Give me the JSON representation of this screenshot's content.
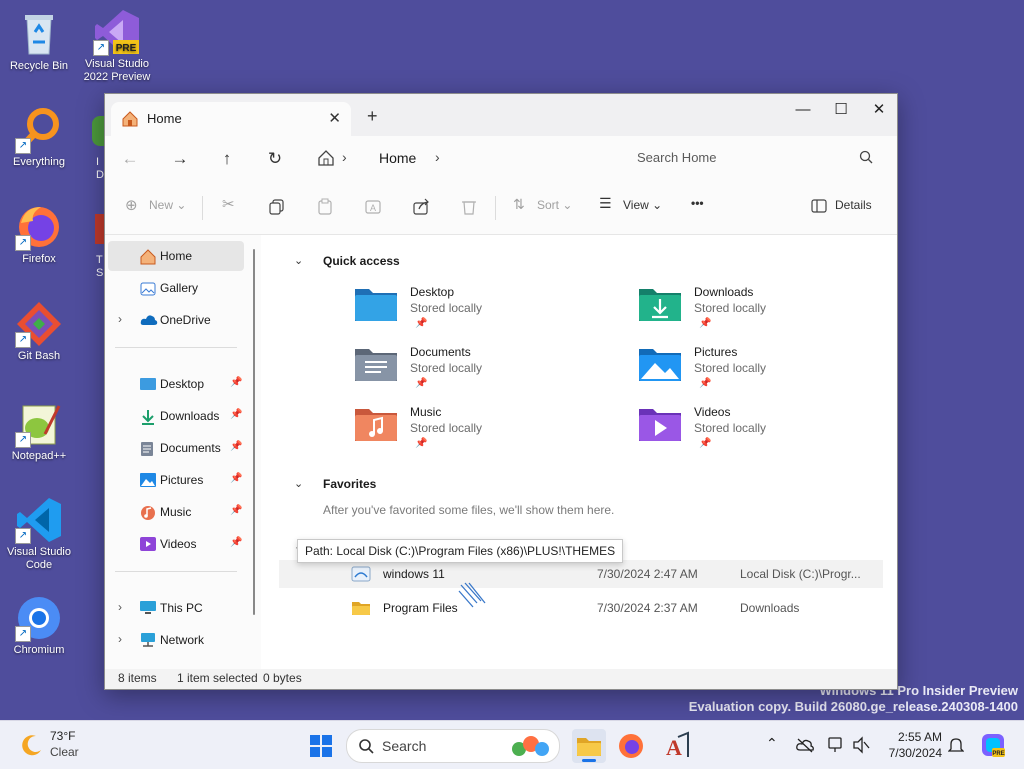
{
  "desktop": {
    "icons": [
      {
        "label": "Recycle Bin",
        "icon": "recycle-bin-icon"
      },
      {
        "label": "Visual Studio 2022 Preview",
        "icon": "visual-studio-preview-icon"
      },
      {
        "label": "Everything",
        "icon": "everything-search-icon"
      },
      {
        "label": "Firefox",
        "icon": "firefox-icon"
      },
      {
        "label": "Git Bash",
        "icon": "git-bash-icon"
      },
      {
        "label": "Notepad++",
        "icon": "notepad-plus-plus-icon"
      },
      {
        "label": "Visual Studio Code",
        "icon": "vscode-icon"
      },
      {
        "label": "Chromium",
        "icon": "chromium-icon"
      }
    ],
    "partial_labels": [
      "I",
      "D",
      "T",
      "S"
    ],
    "watermark_line1": "Windows 11 Pro Insider Preview",
    "watermark_line2": "Evaluation copy. Build 26080.ge_release.240308-1400"
  },
  "explorer": {
    "tab_title": "Home",
    "new_tab": "+",
    "window_controls": {
      "minimize": "—",
      "maximize": "☐",
      "close": "✕"
    },
    "nav": {
      "back": "←",
      "forward": "→",
      "up": "↑",
      "refresh": "↻"
    },
    "address": {
      "crumb": "Home"
    },
    "search_placeholder": "Search Home",
    "toolbar": {
      "new": "New",
      "sort": "Sort",
      "view": "View",
      "more": "•••",
      "details": "Details"
    },
    "sidebar": {
      "top": [
        {
          "label": "Home",
          "selected": true
        },
        {
          "label": "Gallery"
        },
        {
          "label": "OneDrive"
        }
      ],
      "pinned": [
        {
          "label": "Desktop"
        },
        {
          "label": "Downloads"
        },
        {
          "label": "Documents"
        },
        {
          "label": "Pictures"
        },
        {
          "label": "Music"
        },
        {
          "label": "Videos"
        }
      ],
      "bottom": [
        {
          "label": "This PC"
        },
        {
          "label": "Network"
        }
      ]
    },
    "quick_access": {
      "title": "Quick access",
      "items": [
        {
          "name": "Desktop",
          "sub": "Stored locally"
        },
        {
          "name": "Downloads",
          "sub": "Stored locally"
        },
        {
          "name": "Documents",
          "sub": "Stored locally"
        },
        {
          "name": "Pictures",
          "sub": "Stored locally"
        },
        {
          "name": "Music",
          "sub": "Stored locally"
        },
        {
          "name": "Videos",
          "sub": "Stored locally"
        }
      ]
    },
    "favorites": {
      "title": "Favorites",
      "empty_message": "After you've favorited some files, we'll show them here."
    },
    "recent": [
      {
        "name": "windows 11",
        "date": "7/30/2024 2:47 AM",
        "location": "Local Disk (C:)\\Progr..."
      },
      {
        "name": "Program Files",
        "date": "7/30/2024 2:37 AM",
        "location": "Downloads"
      }
    ],
    "tooltip": "Path: Local Disk (C:)\\Program Files (x86)\\PLUS!\\THEMES",
    "status": {
      "items": "8 items",
      "selected": "1 item selected",
      "size": "0 bytes"
    }
  },
  "taskbar": {
    "weather_temp": "73°F",
    "weather_cond": "Clear",
    "search_placeholder": "Search",
    "time": "2:55 AM",
    "date": "7/30/2024"
  }
}
